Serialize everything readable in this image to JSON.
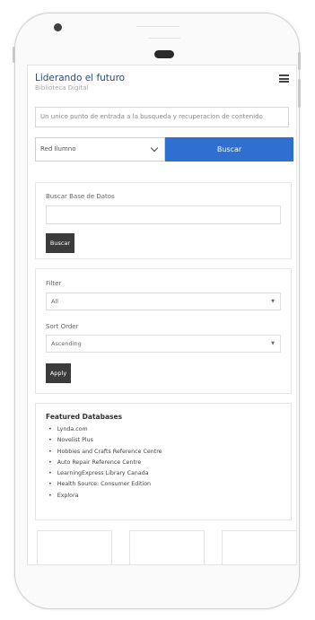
{
  "header": {
    "title": "Liderando el futuro",
    "subtitle": "Biblioteca Digital",
    "menu_icon": "hamburger-menu-icon"
  },
  "search": {
    "placeholder": "Un unico punto de entrada a la busqueda y recuperacion de contenido",
    "source_selected": "Red Ilumno",
    "button_label": "Buscar"
  },
  "database_search": {
    "label": "Buscar Base de Datos",
    "input_value": "",
    "button_label": "Buscar"
  },
  "filters": {
    "filter_label": "Filter",
    "filter_value": "All",
    "sort_label": "Sort Order",
    "sort_value": "Ascending",
    "apply_label": "Apply"
  },
  "featured": {
    "title": "Featured Databases",
    "items": [
      "Lynda.com",
      "Novelist Plus",
      "Hobbies and Crafts Reference Centre",
      "Auto Repair Reference Centre",
      "LearningExpress Library Canada",
      "Health Source: Consumer Edition",
      "Explora"
    ]
  },
  "colors": {
    "accent": "#2e6fcf",
    "title": "#2f4a7a",
    "dark_button": "#3b3b3b"
  }
}
